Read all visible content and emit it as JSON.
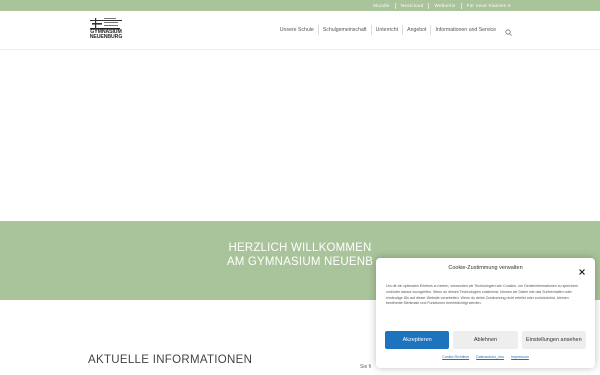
{
  "topnav": {
    "links": [
      "Moodle",
      "Nextcloud",
      "Webuntis",
      "Für neue Klassen 5"
    ]
  },
  "logo": {
    "line1": "GYMNASIUM",
    "line2": "NEUENBURG"
  },
  "mainnav": {
    "items": [
      "Unsere Schule",
      "Schulgemeinschaft",
      "Unterricht",
      "Angebot",
      "Informationen und Service"
    ]
  },
  "banner": {
    "line1": "HERZLICH WILLKOMMEN",
    "line2": "AM GYMNASIUM NEUENB"
  },
  "main": {
    "section_title": "AKTUELLE INFORMATIONEN",
    "side_snippet": "Sie fi"
  },
  "cookie": {
    "title": "Cookie-Zustimmung verwalten",
    "text": "Um dir ein optimales Erlebnis zu bieten, verwenden wir Technologien wie Cookies, um Geräteinformationen zu speichern und/oder darauf zuzugreifen. Wenn du diesen Technologien zustimmst, können wir Daten wie das Surfverhalten oder eindeutige IDs auf dieser Website verarbeiten. Wenn du deine Zustimmung nicht erteilst oder zurückziehst, können bestimmte Merkmale und Funktionen beeinträchtigt werden.",
    "accept_label": "Akzeptieren",
    "decline_label": "Ablehnen",
    "settings_label": "Einstellungen ansehen",
    "links": [
      "Cookie-Richtlinie",
      "Datenschutz_neu",
      "Impressum"
    ]
  },
  "colors": {
    "accent_green": "#a9c39a",
    "button_blue": "#1e73be"
  }
}
